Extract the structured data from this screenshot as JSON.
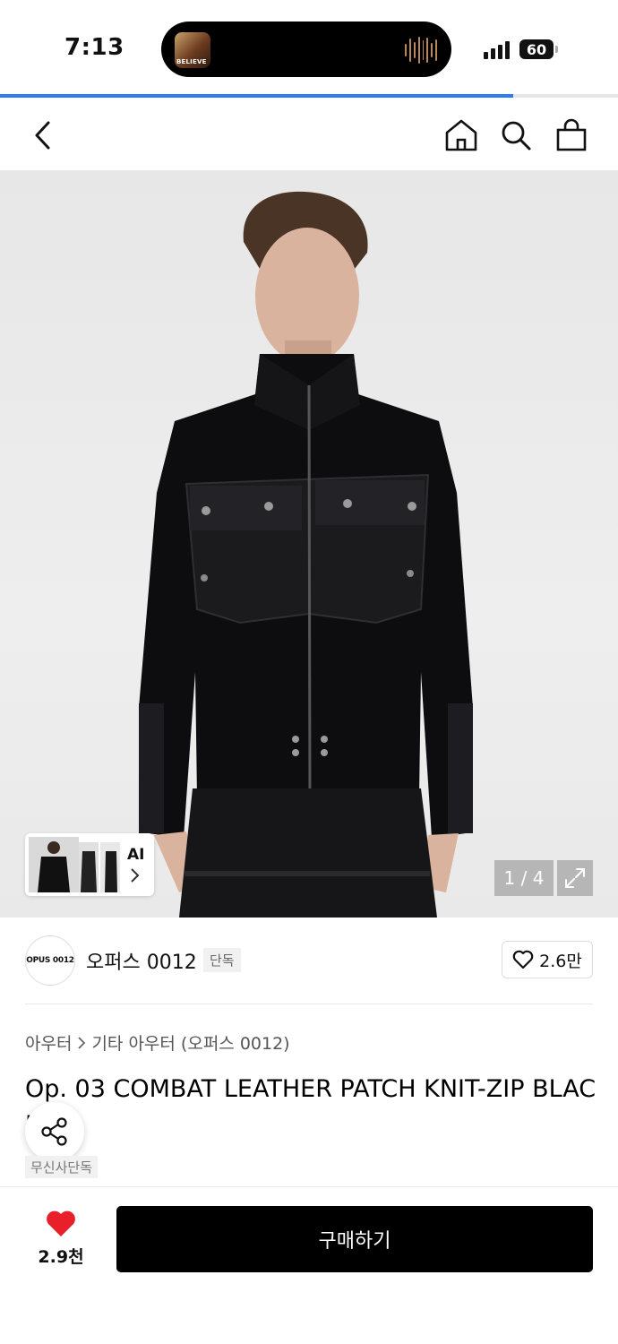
{
  "status_bar": {
    "time": "7:13",
    "battery": "60",
    "now_playing_art_text": "BELIEVE"
  },
  "page_progress": 0.83,
  "nav": {
    "back_icon": "chevron-left-icon",
    "home_icon": "home-icon",
    "search_icon": "search-icon",
    "cart_icon": "shopping-bag-icon"
  },
  "gallery": {
    "ai_label": "AI",
    "counter": "1 / 4",
    "expand_icon": "expand-arrows-icon"
  },
  "brand": {
    "logo_text": "OPUS 0012",
    "name": "오퍼스 0012",
    "badge": "단독",
    "likes": "2.6만"
  },
  "breadcrumb": {
    "category": "아우터",
    "subcategory": "기타 아우터 (오퍼스 0012)"
  },
  "product": {
    "title": "Op. 03 COMBAT LEATHER PATCH KNIT-ZIP BLACK",
    "exclusive_tag": "무신사단독"
  },
  "bottom_bar": {
    "wishlist_count": "2.9천",
    "buy_label": "구매하기"
  },
  "colors": {
    "accent_blue": "#2d7cf6",
    "heart_red": "#e8202a",
    "buy_button": "#000000"
  }
}
